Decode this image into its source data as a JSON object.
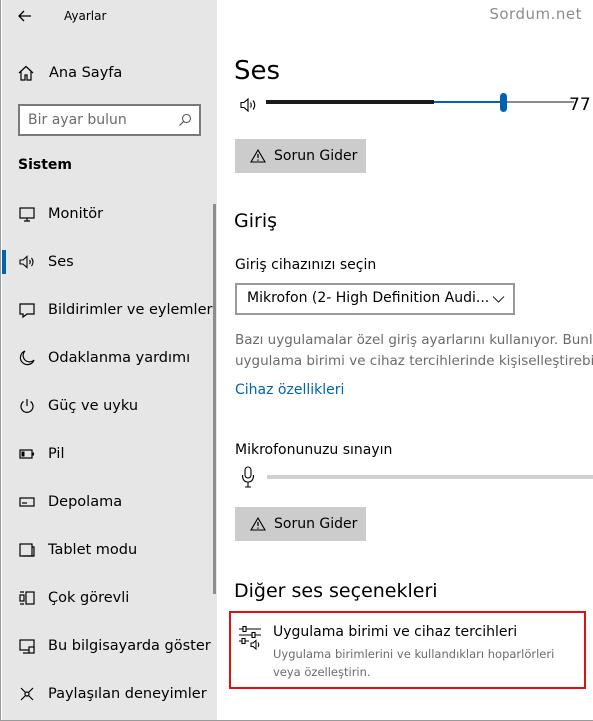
{
  "window": {
    "title": "Ayarlar",
    "watermark": "Sordum.net"
  },
  "sidebar": {
    "home_label": "Ana Sayfa",
    "search_placeholder": "Bir ayar bulun",
    "section_title": "Sistem",
    "items": [
      {
        "label": "Monitör",
        "icon": "monitor-icon"
      },
      {
        "label": "Ses",
        "icon": "speaker-icon",
        "active": true
      },
      {
        "label": "Bildirimler ve eylemler",
        "icon": "notification-icon"
      },
      {
        "label": "Odaklanma yardımı",
        "icon": "moon-icon"
      },
      {
        "label": "Güç ve uyku",
        "icon": "power-icon"
      },
      {
        "label": "Pil",
        "icon": "battery-icon"
      },
      {
        "label": "Depolama",
        "icon": "storage-icon"
      },
      {
        "label": "Tablet modu",
        "icon": "tablet-icon"
      },
      {
        "label": "Çok görevli",
        "icon": "multitasking-icon"
      },
      {
        "label": "Bu bilgisayarda göster",
        "icon": "project-icon"
      },
      {
        "label": "Paylaşılan deneyimler",
        "icon": "shared-icon"
      }
    ]
  },
  "main": {
    "title": "Ses",
    "volume": {
      "value": "77",
      "level_fraction": 0.77
    },
    "troubleshoot_label": "Sorun Gider",
    "input": {
      "heading": "Giriş",
      "device_label": "Giriş cihazınızı seçin",
      "device_value": "Mikrofon (2- High Definition Audi...",
      "desc_line1": "Bazı uygulamalar özel giriş ayarlarını kullanıyor. Bunlar",
      "desc_line2": "uygulama birimi ve cihaz tercihlerinde kişiselleştirebilir",
      "device_properties_link": "Cihaz özellikleri",
      "test_label": "Mikrofonunuzu sınayın",
      "troubleshoot_label": "Sorun Gider"
    },
    "other": {
      "heading": "Diğer ses seçenekleri",
      "app_volume_title": "Uygulama birimi ve cihaz tercihleri",
      "app_volume_desc": "Uygulama birimlerini ve kullandıkları hoparlörleri veya özelleştirin."
    }
  },
  "colors": {
    "accent": "#0063b1",
    "sidebar_bg": "#e6e6e6",
    "button_bg": "#cccccc",
    "highlight_border": "#e01010"
  }
}
